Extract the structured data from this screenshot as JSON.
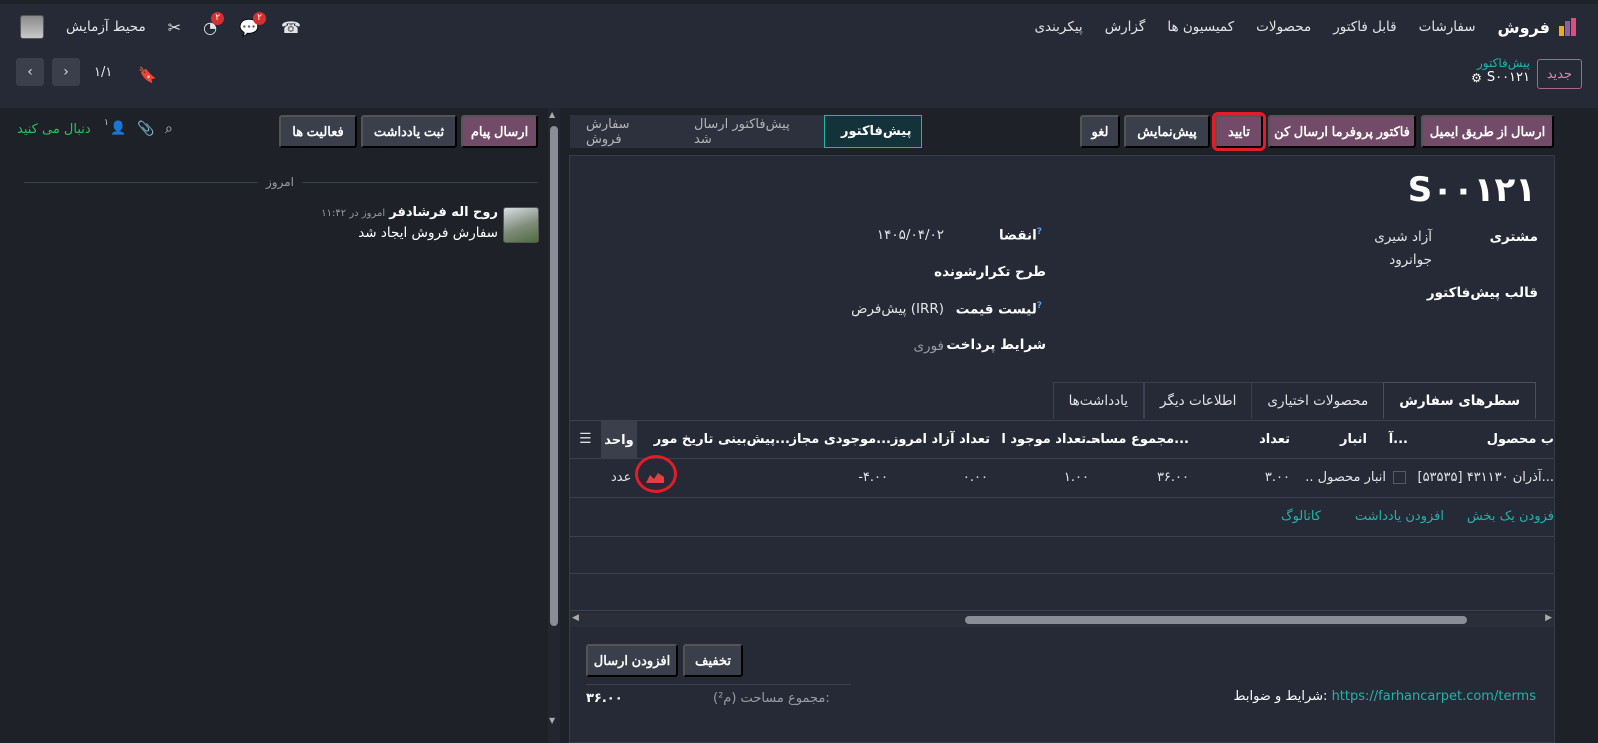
{
  "topbar": {
    "app_name": "فروش",
    "menu": [
      "سفارشات",
      "قابل فاکتور",
      "محصولات",
      "کمیسیون ها",
      "گزارش",
      "پیکربندی"
    ],
    "user_name": "محیط آزمایش",
    "messages_badge": "۲",
    "activity_badge": "۲"
  },
  "control_panel": {
    "new_label": "جدید",
    "breadcrumb_parent": "پیش‌فاکتور",
    "breadcrumb_current": "S۰۰۱۲۱",
    "pager": "۱/۱"
  },
  "actions": {
    "send_email": "ارسال از طریق ایمیل",
    "send_proforma": "فاکتور پروفرما ارسال کن",
    "confirm": "تایید",
    "preview": "پیش‌نمایش",
    "cancel": "لغو"
  },
  "stages": [
    "پیش‌فاکتور",
    "پیش‌فاکتور ارسال شد",
    "سفارش فروش"
  ],
  "form": {
    "title": "S۰۰۱۲۱",
    "customer_label": "مشتری",
    "customer_name": "آزاد شیری",
    "customer_city": "جوانرود",
    "template_label": "قالب پیش‌فاکتور",
    "expiration_label": "انقضا",
    "expiration_value": "۱۴۰۵/۰۴/۰۲",
    "recurrence_label": "طرح تکرارشونده",
    "pricelist_label": "لیست قیمت",
    "pricelist_value": "پیش‌فرض (IRR)",
    "payment_terms_label": "شرایط پرداخت",
    "payment_terms_value": "فوری"
  },
  "tabs": [
    "سطرهای سفارش",
    "محصولات اختیاری",
    "اطلاعات دیگر",
    "یادداشت‌ها"
  ],
  "table": {
    "headers": {
      "product": "ب محصول",
      "a": "آ...",
      "warehouse": "انبار",
      "qty": "تعداد",
      "area_total": "مجموع مساحـ...",
      "qty_on_hand": "تعداد موجود ا...",
      "free_qty": "تعداد آزاد امروز",
      "virtual": "موجودی مجاز...",
      "forecast_date": "پیش‌بینی تاریخ مور...",
      "unit": "واحد"
    },
    "row": {
      "product": "[۵۳۵۳۵] آذران ۴۳۱۱۳۰...",
      "warehouse": ".. انبار محصول",
      "qty": "۳.۰۰",
      "area_total": "۳۶.۰۰",
      "qty_on_hand": "۱.۰۰",
      "free_qty": "۰.۰۰",
      "virtual": "-۴.۰۰",
      "unit": "عدد"
    },
    "add_section": "فزودن یک بخش",
    "add_note": "افزودن یادداشت",
    "catalog": "کاتالوگ"
  },
  "footer": {
    "discount": "تخفیف",
    "add_shipping": "افزودن ارسال",
    "terms_label": "شرایط و ضوابط:",
    "terms_link": "https://farhancarpet.com/terms",
    "area_label": "مجموع مساحت (م²):",
    "area_value": "۳۶.۰۰"
  },
  "chatter": {
    "send_message": "ارسال پیام",
    "log_note": "ثبت یادداشت",
    "activities": "فعالیت ها",
    "follow": "دنبال می کنید",
    "followers_count": "۱",
    "today": "امروز",
    "author": "روح اله فرشادفر",
    "time": "امروز در ۱۱:۴۲",
    "message": "سفارش فروش ایجاد شد"
  },
  "colors": {
    "accent_purple": "#714b67",
    "teal": "#22b3a8",
    "highlight_red": "#e11d2a"
  }
}
